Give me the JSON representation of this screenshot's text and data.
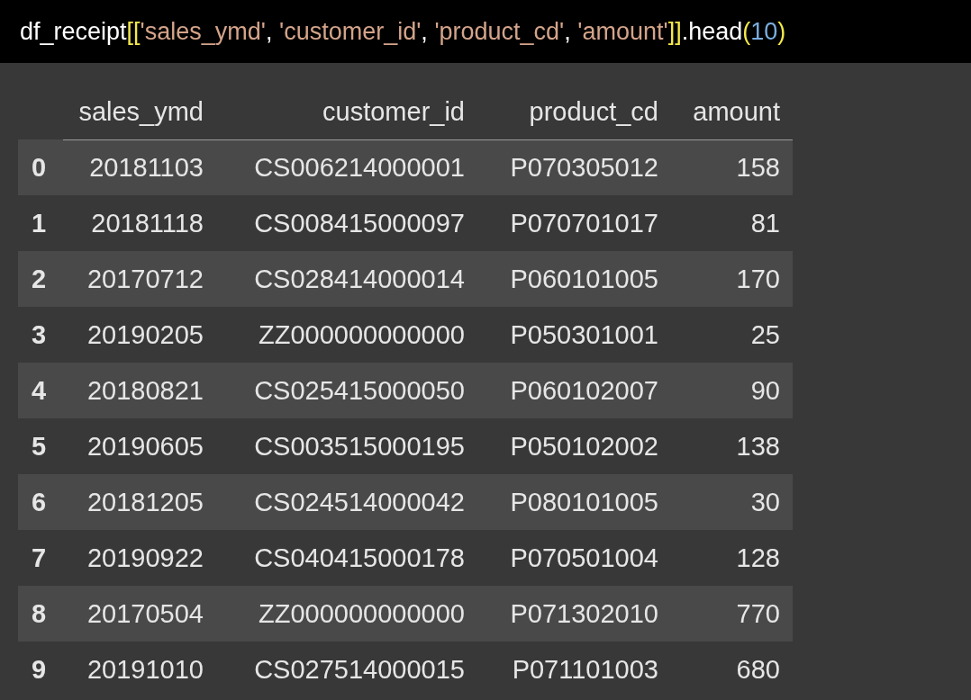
{
  "code": {
    "tokens": [
      {
        "kind": "name",
        "text": "df_receipt"
      },
      {
        "kind": "bracket",
        "text": "[["
      },
      {
        "kind": "string",
        "text": "'sales_ymd'"
      },
      {
        "kind": "punct",
        "text": ", "
      },
      {
        "kind": "string",
        "text": "'customer_id'"
      },
      {
        "kind": "punct",
        "text": ", "
      },
      {
        "kind": "string",
        "text": "'product_cd'"
      },
      {
        "kind": "punct",
        "text": ", "
      },
      {
        "kind": "string",
        "text": "'amount'"
      },
      {
        "kind": "bracket",
        "text": "]]"
      },
      {
        "kind": "name",
        "text": ".head"
      },
      {
        "kind": "bracket",
        "text": "("
      },
      {
        "kind": "number",
        "text": "10"
      },
      {
        "kind": "bracket",
        "text": ")"
      }
    ]
  },
  "table": {
    "columns": [
      "",
      "sales_ymd",
      "customer_id",
      "product_cd",
      "amount"
    ],
    "rows": [
      [
        "0",
        "20181103",
        "CS006214000001",
        "P070305012",
        "158"
      ],
      [
        "1",
        "20181118",
        "CS008415000097",
        "P070701017",
        "81"
      ],
      [
        "2",
        "20170712",
        "CS028414000014",
        "P060101005",
        "170"
      ],
      [
        "3",
        "20190205",
        "ZZ000000000000",
        "P050301001",
        "25"
      ],
      [
        "4",
        "20180821",
        "CS025415000050",
        "P060102007",
        "90"
      ],
      [
        "5",
        "20190605",
        "CS003515000195",
        "P050102002",
        "138"
      ],
      [
        "6",
        "20181205",
        "CS024514000042",
        "P080101005",
        "30"
      ],
      [
        "7",
        "20190922",
        "CS040415000178",
        "P070501004",
        "128"
      ],
      [
        "8",
        "20170504",
        "ZZ000000000000",
        "P071302010",
        "770"
      ],
      [
        "9",
        "20191010",
        "CS027514000015",
        "P071101003",
        "680"
      ]
    ]
  }
}
